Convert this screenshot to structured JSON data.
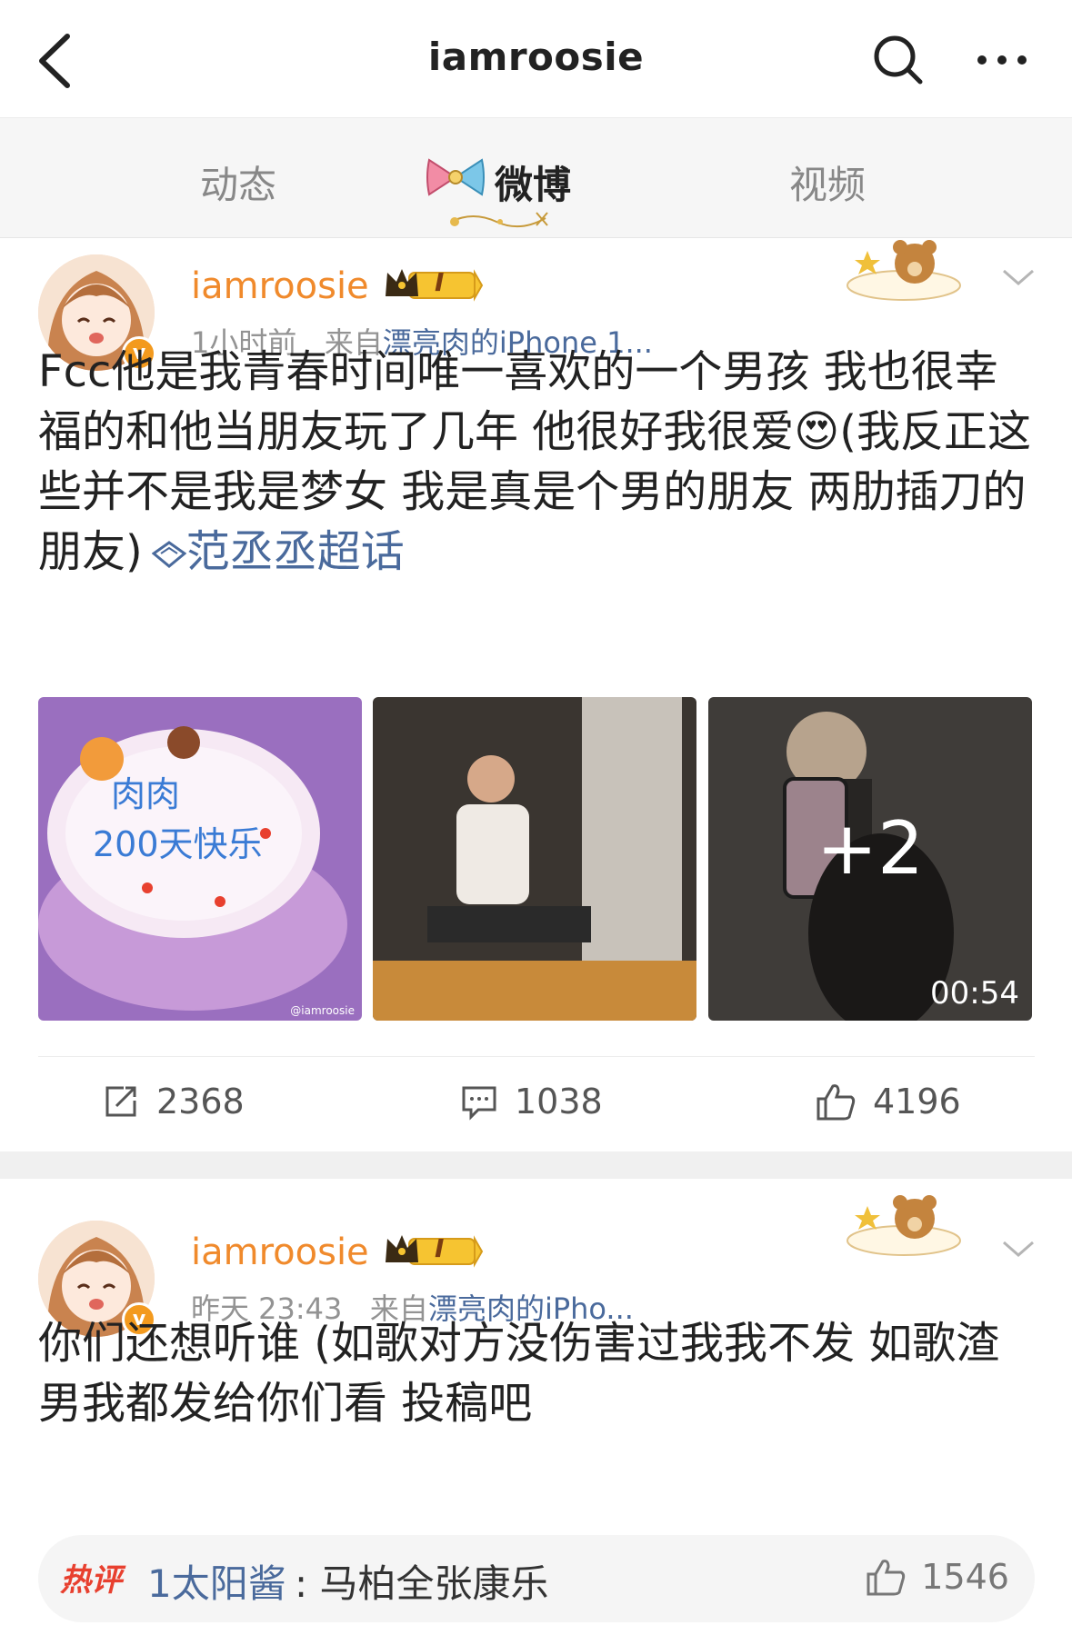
{
  "colors": {
    "accent_orange": "#f08a2c",
    "link_blue": "#4a6a9c",
    "hot_red": "#e8402f",
    "text": "#222222",
    "muted": "#939393"
  },
  "header": {
    "back_icon": "back-arrow-icon",
    "title": "iamroosie",
    "search_icon": "search-icon",
    "more_icon": "more-dots-icon"
  },
  "tabs": [
    {
      "label": "动态",
      "active": false
    },
    {
      "label": "微博",
      "active": true
    },
    {
      "label": "视频",
      "active": false
    }
  ],
  "posts": [
    {
      "username": "iamroosie",
      "member_badge": "I",
      "time": "1小时前",
      "source_prefix": "来自",
      "source": "漂亮肉的iPhone 1...",
      "content": "Fcc他是我青春时间唯一喜欢的一个男孩 我也很幸福的和他当朋友玩了几年  他很好我很爱😍(我反正这些并不是我是梦女 我是真是个男的朋友 两肋插刀的朋友)",
      "topic": "范丞丞超话",
      "images": [
        {
          "desc": "cake",
          "watermark": "@iamroosie"
        },
        {
          "desc": "stage"
        },
        {
          "desc": "phone",
          "more": "+2",
          "duration": "00:54"
        }
      ],
      "actions": {
        "repost": "2368",
        "comment": "1038",
        "like": "4196"
      }
    },
    {
      "username": "iamroosie",
      "member_badge": "I",
      "time": "昨天 23:43",
      "source_prefix": "来自",
      "source": "漂亮肉的iPho...",
      "content": "你们还想听谁 (如歌对方没伤害过我我不发 如歌渣男我都发给你们看 投稿吧",
      "hot_comment": {
        "tag": "热评",
        "user": "1太阳酱",
        "text": ": 马柏全张康乐",
        "likes": "1546"
      }
    }
  ]
}
